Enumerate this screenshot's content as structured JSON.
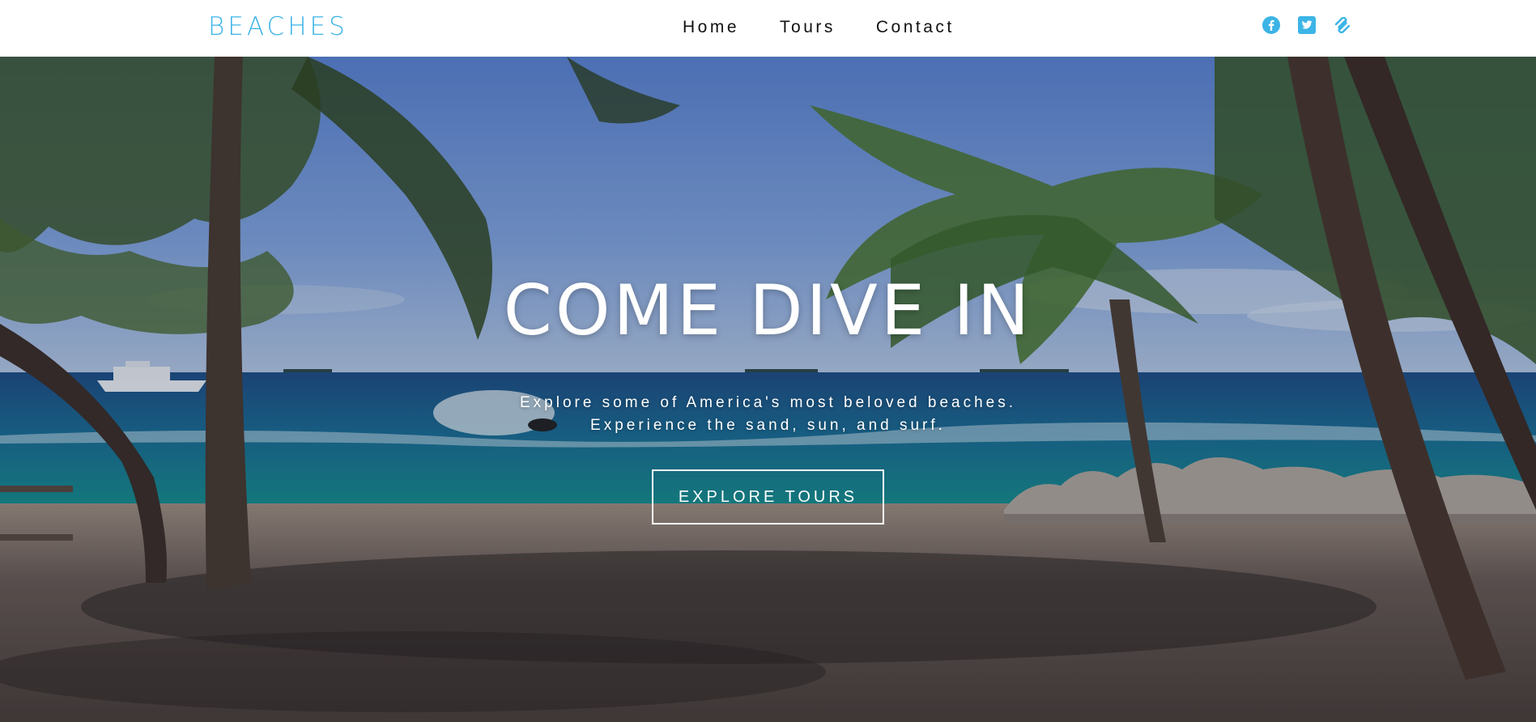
{
  "header": {
    "logo": "BEACHES",
    "nav": [
      {
        "label": "Home"
      },
      {
        "label": "Tours"
      },
      {
        "label": "Contact"
      }
    ],
    "social": [
      {
        "icon": "facebook-icon"
      },
      {
        "icon": "twitter-icon"
      },
      {
        "icon": "squarespace-icon"
      }
    ]
  },
  "hero": {
    "title": "COME DIVE IN",
    "subtitle_line1": "Explore some of America's most beloved beaches.",
    "subtitle_line2": "Experience the sand, sun, and surf.",
    "cta_label": "EXPLORE TOURS"
  },
  "colors": {
    "brand": "#3cb4e6",
    "nav_text": "#111111",
    "hero_text": "#ffffff"
  }
}
